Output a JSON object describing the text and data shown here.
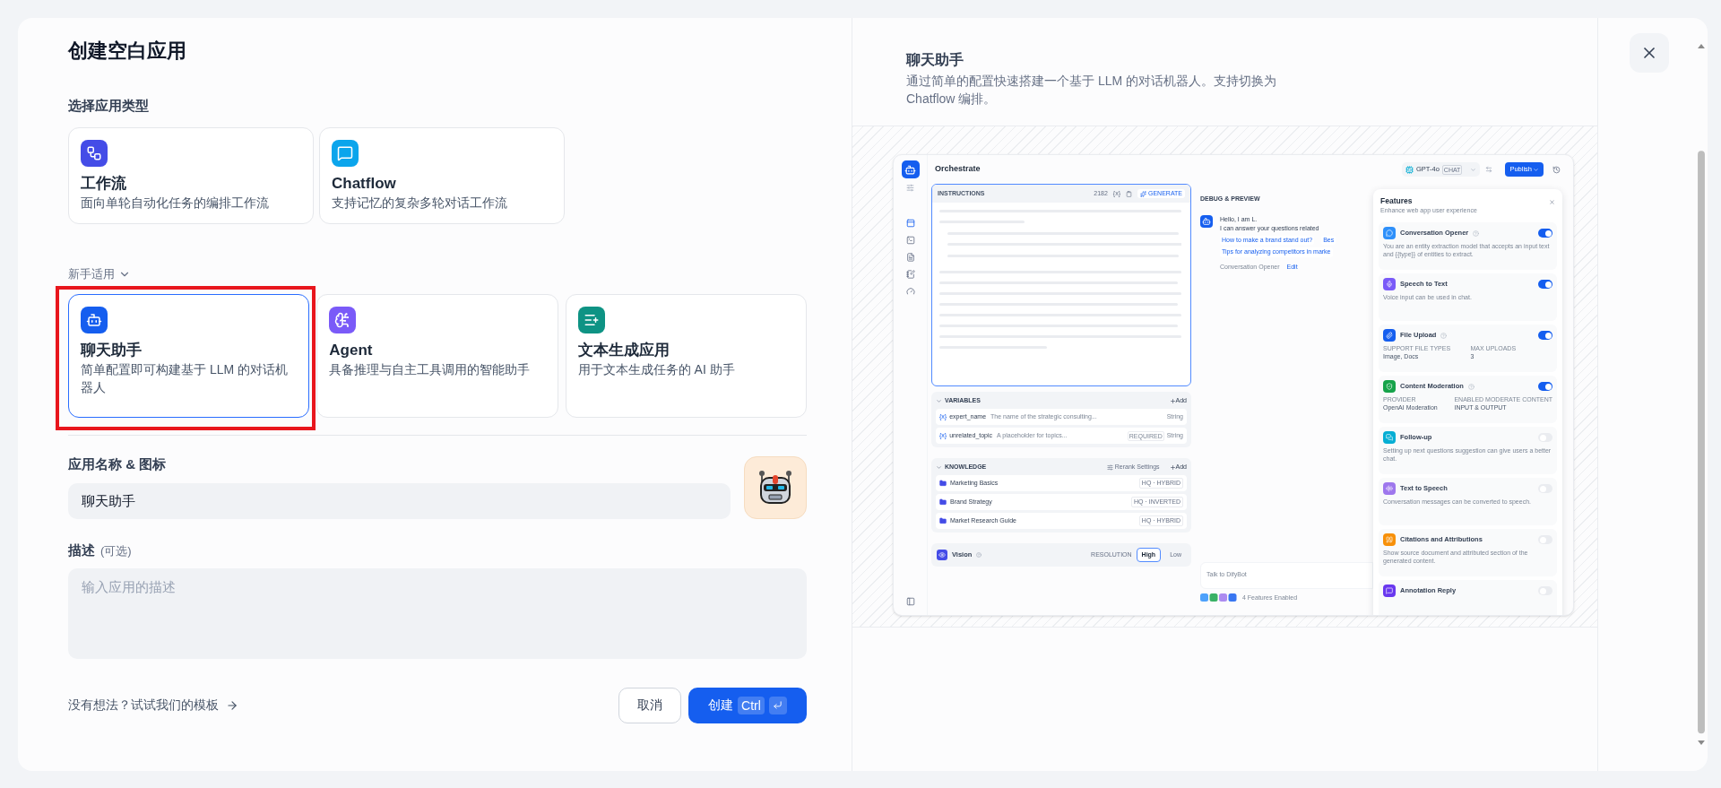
{
  "dialog": {
    "title": "创建空白应用",
    "type_section_label": "选择应用类型",
    "app_types": [
      {
        "kind": "workflow",
        "name": "工作流",
        "description": "面向单轮自动化任务的编排工作流",
        "selected": false,
        "highlighted": false
      },
      {
        "kind": "chatflow",
        "name": "Chatflow",
        "description": "支持记忆的复杂多轮对话工作流",
        "selected": false,
        "highlighted": false
      }
    ],
    "beginner_label": "新手适用",
    "beginner_types": [
      {
        "kind": "chatbot",
        "name": "聊天助手",
        "description": "简单配置即可构建基于 LLM 的对话机器人",
        "selected": true,
        "highlighted": true
      },
      {
        "kind": "agent",
        "name": "Agent",
        "description": "具备推理与自主工具调用的智能助手",
        "selected": false,
        "highlighted": false
      },
      {
        "kind": "completion",
        "name": "文本生成应用",
        "description": "用于文本生成任务的 AI 助手",
        "selected": false,
        "highlighted": false
      }
    ],
    "name_label": "应用名称 & 图标",
    "name_value": "聊天助手",
    "description_label": "描述",
    "description_optional": "(可选)",
    "description_placeholder": "输入应用的描述",
    "template_link": "没有想法？试试我们的模板",
    "cancel": "取消",
    "create": "创建",
    "create_shortcut": "Ctrl"
  },
  "preview": {
    "title": "聊天助手",
    "description": "通过简单的配置快速搭建一个基于 LLM 的对话机器人。支持切换为 Chatflow 编排。",
    "screenshot": {
      "title": "Orchestrate",
      "model": "GPT-4o",
      "model_mode": "CHAT",
      "publish": "Publish",
      "instructions": {
        "label": "INSTRUCTIONS",
        "count": "2182",
        "variable_token": "{x}",
        "generate": "GENERATE"
      },
      "variables": {
        "label": "VARIABLES",
        "add": "Add",
        "items": [
          {
            "token": "{x}",
            "name": "expert_name",
            "description": "The name of the strategic consulting...",
            "type": "String"
          },
          {
            "token": "{x}",
            "name": "unrelated_topic",
            "description": "A placeholder for topics...",
            "badge": "REQUIRED",
            "type": "String"
          }
        ]
      },
      "knowledge": {
        "label": "KNOWLEDGE",
        "rerank": "Rerank Settings",
        "add": "Add",
        "items": [
          {
            "name": "Marketing Basics",
            "mode": "HQ · HYBRID"
          },
          {
            "name": "Brand Strategy",
            "mode": "HQ · INVERTED"
          },
          {
            "name": "Market Research Guide",
            "mode": "HQ · HYBRID"
          }
        ]
      },
      "vision": {
        "label": "Vision",
        "resolution_label": "RESOLUTION",
        "options": [
          {
            "label": "High",
            "selected": true
          },
          {
            "label": "Low",
            "selected": false
          }
        ]
      },
      "debug": {
        "title": "DEBUG & PREVIEW",
        "greeting": "Hello, I am L.",
        "intro": "I can answer your questions related",
        "suggestion_rows": [
          [
            "How to make a brand stand out?",
            "Bes"
          ],
          [
            "Tips for analyzing competitors in marke"
          ]
        ],
        "opener_label": "Conversation Opener",
        "edit": "Edit",
        "input_placeholder": "Talk to DifyBot",
        "features_enabled": "4 Features Enabled"
      },
      "features": {
        "title": "Features",
        "subtitle": "Enhance web app user experience",
        "items": [
          {
            "kind": "text",
            "name": "Conversation Opener",
            "help": true,
            "on": true,
            "color": "#2e90fa",
            "description": "You are an entity extraction model that accepts an input text and {{type}} of entities to extract."
          },
          {
            "kind": "text",
            "name": "Speech to Text",
            "help": false,
            "on": true,
            "color": "#7a5af8",
            "description": "Voice input can be used in chat."
          },
          {
            "kind": "fields",
            "name": "File Upload",
            "help": true,
            "on": true,
            "color": "#155eef",
            "fields": [
              {
                "label": "SUPPORT FILE TYPES",
                "value": "Image, Docs"
              },
              {
                "label": "MAX UPLOADS",
                "value": "3"
              }
            ]
          },
          {
            "kind": "fields",
            "name": "Content Moderation",
            "help": true,
            "on": true,
            "color": "#16a34a",
            "fields": [
              {
                "label": "PROVIDER",
                "value": "OpenAI Moderation"
              },
              {
                "label": "ENABLED MODERATE CONTENT",
                "value": "INPUT & OUTPUT"
              }
            ]
          },
          {
            "kind": "text",
            "name": "Follow-up",
            "help": false,
            "on": false,
            "color": "#06aed4",
            "description": "Setting up next questions suggestion can give users a better chat."
          },
          {
            "kind": "text",
            "name": "Text to Speech",
            "help": false,
            "on": false,
            "color": "#9e77ed",
            "description": "Conversation messages can be converted to speech."
          },
          {
            "kind": "text",
            "name": "Citations and Attributions",
            "help": false,
            "on": false,
            "color": "#f79009",
            "description": "Show source document and attributed section of the generated content."
          },
          {
            "kind": "text",
            "name": "Annotation Reply",
            "help": false,
            "on": false,
            "color": "#6938ef"
          }
        ]
      }
    }
  }
}
